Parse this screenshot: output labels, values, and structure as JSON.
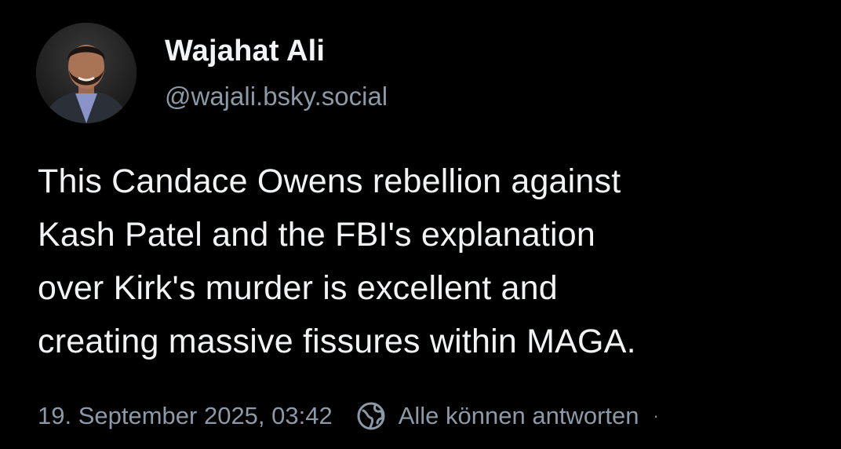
{
  "author": {
    "display_name": "Wajahat Ali",
    "handle": "@wajali.bsky.social",
    "avatar_icon": "profile-photo"
  },
  "post": {
    "text": "This Candace Owens rebellion against\nKash Patel and the FBI's explanation\nover Kirk's murder is excellent and\ncreating massive fissures within MAGA."
  },
  "meta": {
    "timestamp": "19. September 2025, 03:42",
    "reply_icon": "globe-icon",
    "reply_setting": "Alle können antworten",
    "separator": "·"
  },
  "colors": {
    "background": "#000000",
    "text_primary": "#f1f3f5",
    "text_secondary": "#8c99a7"
  }
}
